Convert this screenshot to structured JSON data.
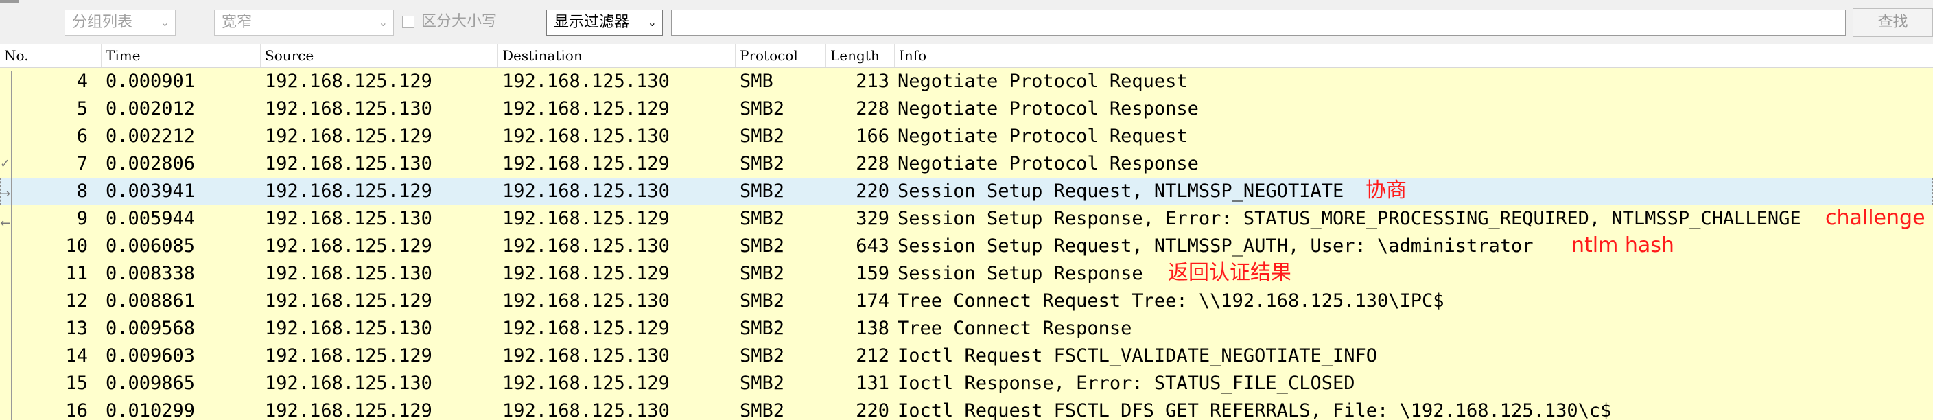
{
  "toolbar": {
    "search_in": "分组列表",
    "char_width": "宽窄",
    "case_sensitive_label": "区分大小写",
    "search_type": "显示过滤器",
    "search_value": "",
    "find_label": "查找"
  },
  "columns": {
    "no": "No.",
    "time": "Time",
    "source": "Source",
    "destination": "Destination",
    "protocol": "Protocol",
    "length": "Length",
    "info": "Info"
  },
  "packets": [
    {
      "no": "4",
      "time": "0.000901",
      "source": "192.168.125.129",
      "destination": "192.168.125.130",
      "protocol": "SMB",
      "length": "213",
      "info": "Negotiate Protocol Request",
      "note": ""
    },
    {
      "no": "5",
      "time": "0.002012",
      "source": "192.168.125.130",
      "destination": "192.168.125.129",
      "protocol": "SMB2",
      "length": "228",
      "info": "Negotiate Protocol Response",
      "note": ""
    },
    {
      "no": "6",
      "time": "0.002212",
      "source": "192.168.125.129",
      "destination": "192.168.125.130",
      "protocol": "SMB2",
      "length": "166",
      "info": "Negotiate Protocol Request",
      "note": ""
    },
    {
      "no": "7",
      "time": "0.002806",
      "source": "192.168.125.130",
      "destination": "192.168.125.129",
      "protocol": "SMB2",
      "length": "228",
      "info": "Negotiate Protocol Response",
      "note": ""
    },
    {
      "no": "8",
      "time": "0.003941",
      "source": "192.168.125.129",
      "destination": "192.168.125.130",
      "protocol": "SMB2",
      "length": "220",
      "info": "Session Setup Request, NTLMSSP_NEGOTIATE",
      "note": "协商"
    },
    {
      "no": "9",
      "time": "0.005944",
      "source": "192.168.125.130",
      "destination": "192.168.125.129",
      "protocol": "SMB2",
      "length": "329",
      "info": "Session Setup Response, Error: STATUS_MORE_PROCESSING_REQUIRED, NTLMSSP_CHALLENGE",
      "note": "challenge"
    },
    {
      "no": "10",
      "time": "0.006085",
      "source": "192.168.125.129",
      "destination": "192.168.125.130",
      "protocol": "SMB2",
      "length": "643",
      "info": "Session Setup Request, NTLMSSP_AUTH, User: \\administrator",
      "note": "ntlm hash"
    },
    {
      "no": "11",
      "time": "0.008338",
      "source": "192.168.125.130",
      "destination": "192.168.125.129",
      "protocol": "SMB2",
      "length": "159",
      "info": "Session Setup Response",
      "note": "返回认证结果"
    },
    {
      "no": "12",
      "time": "0.008861",
      "source": "192.168.125.129",
      "destination": "192.168.125.130",
      "protocol": "SMB2",
      "length": "174",
      "info": "Tree Connect Request Tree: \\\\192.168.125.130\\IPC$",
      "note": ""
    },
    {
      "no": "13",
      "time": "0.009568",
      "source": "192.168.125.130",
      "destination": "192.168.125.129",
      "protocol": "SMB2",
      "length": "138",
      "info": "Tree Connect Response",
      "note": ""
    },
    {
      "no": "14",
      "time": "0.009603",
      "source": "192.168.125.129",
      "destination": "192.168.125.130",
      "protocol": "SMB2",
      "length": "212",
      "info": "Ioctl Request FSCTL_VALIDATE_NEGOTIATE_INFO",
      "note": ""
    },
    {
      "no": "15",
      "time": "0.009865",
      "source": "192.168.125.130",
      "destination": "192.168.125.129",
      "protocol": "SMB2",
      "length": "131",
      "info": "Ioctl Response, Error: STATUS_FILE_CLOSED",
      "note": ""
    },
    {
      "no": "16",
      "time": "0.010299",
      "source": "192.168.125.129",
      "destination": "192.168.125.130",
      "protocol": "SMB2",
      "length": "220",
      "info": "Ioctl Request FSCTL_DFS_GET_REFERRALS, File: \\192.168.125.130\\c$",
      "note": ""
    }
  ],
  "selected_packet": "8",
  "colors": {
    "row_background": "#ffffcd",
    "selected_row": "#dff0f8",
    "annotation": "#ff1a1a"
  }
}
